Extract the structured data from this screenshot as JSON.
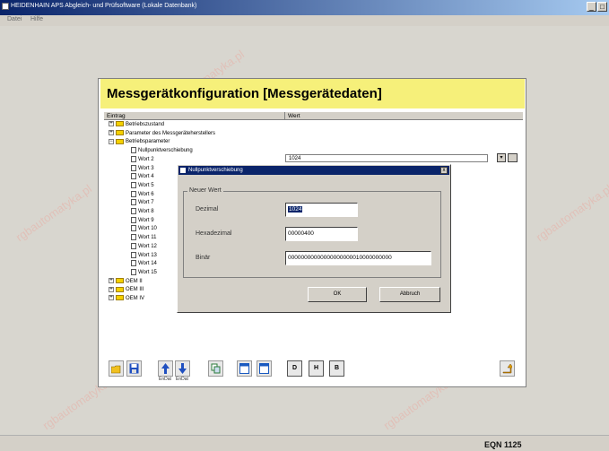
{
  "window": {
    "title": "HEIDENHAIN APS Abgleich- und Prüfsoftware (Lokale Datenbank)",
    "menu": [
      "Datei",
      "Hilfe"
    ],
    "controls": [
      "_",
      "□"
    ]
  },
  "banner": {
    "title": "Messgerätkonfiguration [Messgerätedaten]"
  },
  "tree": {
    "columns": [
      "Eintrag",
      "Wert"
    ],
    "items": [
      {
        "label": "Betriebszustand",
        "type": "folder",
        "expander": "+"
      },
      {
        "label": "Parameter des Messgeräteherstellers",
        "type": "folder",
        "expander": "+"
      },
      {
        "label": "Betriebsparameter",
        "type": "folder",
        "expander": "−"
      },
      {
        "label": "Nullpunktverschiebung",
        "type": "doc",
        "value": "1024"
      },
      {
        "label": "Wort 2",
        "type": "doc"
      },
      {
        "label": "Wort 3",
        "type": "doc"
      },
      {
        "label": "Wort 4",
        "type": "doc"
      },
      {
        "label": "Wort 5",
        "type": "doc"
      },
      {
        "label": "Wort 6",
        "type": "doc"
      },
      {
        "label": "Wort 7",
        "type": "doc"
      },
      {
        "label": "Wort 8",
        "type": "doc"
      },
      {
        "label": "Wort 9",
        "type": "doc"
      },
      {
        "label": "Wort 10",
        "type": "doc"
      },
      {
        "label": "Wort 11",
        "type": "doc"
      },
      {
        "label": "Wort 12",
        "type": "doc"
      },
      {
        "label": "Wort 13",
        "type": "doc"
      },
      {
        "label": "Wort 14",
        "type": "doc"
      },
      {
        "label": "Wort 15",
        "type": "doc"
      },
      {
        "label": "OEM II",
        "type": "folder",
        "expander": "+"
      },
      {
        "label": "OEM III",
        "type": "folder",
        "expander": "+"
      },
      {
        "label": "OEM IV",
        "type": "folder",
        "expander": "+"
      }
    ],
    "dropdown_arrow": "▾"
  },
  "dialog": {
    "title": "Nullpunktverschiebung",
    "close": "x",
    "group_label": "Neuer Wert",
    "fields": {
      "dezimal": {
        "label": "Dezimal",
        "value": "1024"
      },
      "hexadezimal": {
        "label": "Hexadezimal",
        "value": "00000400"
      },
      "binaer": {
        "label": "Binär",
        "value": "00000000000000000000010000000000"
      }
    },
    "ok_label": "OK",
    "cancel_label": "Abbruch"
  },
  "toolbar": {
    "captions": [
      "EnDat",
      "EnDat"
    ],
    "letters": [
      "D",
      "H",
      "B"
    ]
  },
  "status": {
    "model": "EQN 1125"
  },
  "watermark": "rgbautomatyka.pl",
  "colors": {
    "banner": "#f6f07a",
    "titlebar": "#0a246a",
    "selection": "#0a246a"
  }
}
